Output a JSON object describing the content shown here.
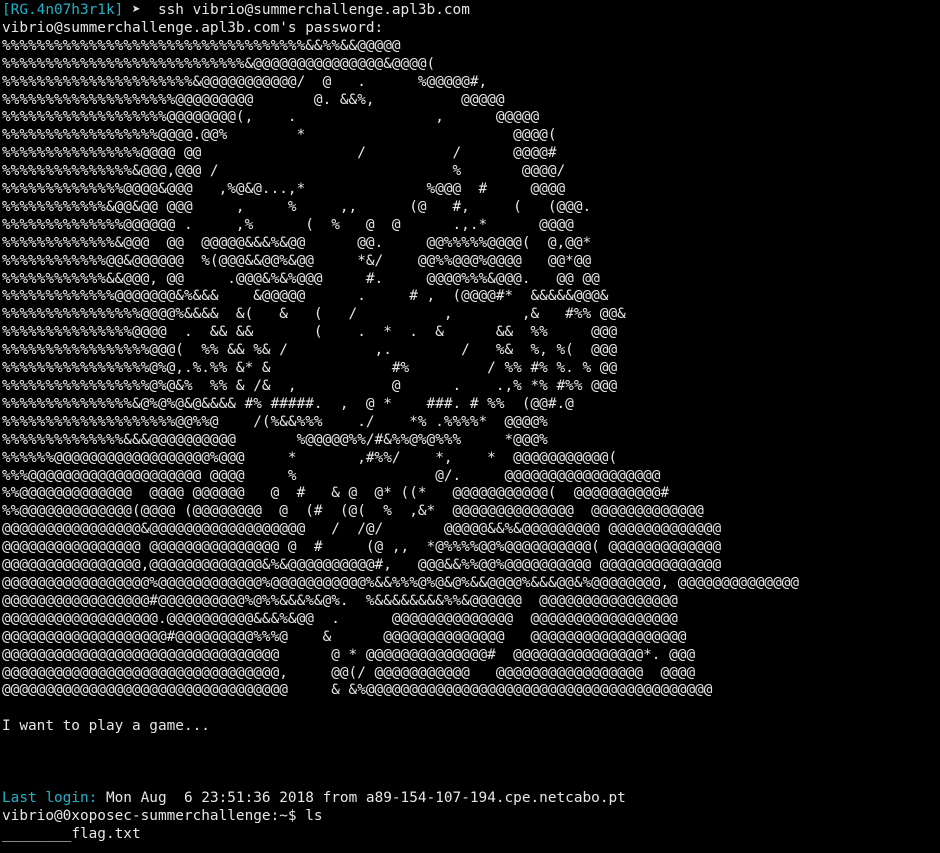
{
  "colors": {
    "background": "#000000",
    "foreground": "#e6e6e6",
    "accent_cyan": "#20b2c6"
  },
  "terminal": {
    "local_prompt": {
      "host_tag": "[RG.4n07h3r1k]",
      "arrow": "➤",
      "command": "ssh vibrio@summerchallenge.apl3b.com"
    },
    "password_prompt": "vibrio@summerchallenge.apl3b.com's password:",
    "ascii_art": [
      "%%%%%%%%%%%%%%%%%%%%%%%%%%%%%%%%%%%&&%%&&@@@@@",
      "%%%%%%%%%%%%%%%%%%%%%%%%%%%%&@@@@@@@@@@@@@@@&@@@@(",
      "%%%%%%%%%%%%%%%%%%%%%%&@@@@@@@@@@@/  @   .      %@@@@@#,",
      "%%%%%%%%%%%%%%%%%%%%@@@@@@@@@       @. &&%,          @@@@@",
      "%%%%%%%%%%%%%%%%%%%@@@@@@@@(,    .                ,      @@@@@",
      "%%%%%%%%%%%%%%%%%%@@@@.@@%        *                        @@@@(",
      "%%%%%%%%%%%%%%%%@@@@ @@                  /          /      @@@@#",
      "%%%%%%%%%%%%%%%&@@@,@@@ /                           %       @@@@/",
      "%%%%%%%%%%%%%%@@@@&@@@   ,%@&@...,*              %@@@  #     @@@@",
      "%%%%%%%%%%%%&@@&@@ @@@     ,     %     ,,      (@   #,     (   (@@@.",
      "%%%%%%%%%%%%%%@@@@@@ .     ,%      (  %   @  @      .,.*      @@@@",
      "%%%%%%%%%%%%%&@@@  @@  @@@@@&&&%&@@      @@.     @@%%%%%@@@@(  @,@@*",
      "%%%%%%%%%%%%@@&@@@@@@  %(@@@&&@@%&@@     *&/    @@%%@@@%@@@@   @@*@@",
      "%%%%%%%%%%%%&&@@@, @@     .@@@&%&%@@@     #.     @@@@%%%&@@@.   @@ @@",
      "%%%%%%%%%%%%%@@@@@@@&%&&&    &@@@@@      .     # ,  (@@@@#*  &&&&&@@@&",
      "%%%%%%%%%%%%%%%%@@@@%&&&&  &(   &   (   /          ,        ,&   #%% @@&",
      "%%%%%%%%%%%%%%%@@@@  .  && &&       (    .  *  .  &      &&  %%     @@@",
      "%%%%%%%%%%%%%%%%%@@@(  %% && %& /          ,.        /   %&  %, %(  @@@",
      "%%%%%%%%%%%%%%%%%@%@,.%.%% &* &              #%         / %% #% %. % @@",
      "%%%%%%%%%%%%%%%%%@%@&%  %% & /&  ,           @      .    .,% *% #%% @@@",
      "%%%%%%%%%%%%%%%&@%@%@&@&&&& #% #####.  ,  @ *    ###. # %%  (@@#.@",
      "%%%%%%%%%%%%%%%%%%%%@@%%@    /(%&&%%%    ./    *% .%%%%*  @@@@%",
      "%%%%%%%%%%%%%%&&&@@@@@@@@@@       %@@@@@%%/#&%%@%@%%%     *@@@%",
      "%%%%%%@@@@@@@@@@@@@@@@@@%@@@     *       ,#%%/    *,    *  @@@@@@@@@@@(",
      "%%%@@@@@@@@@@@@@@@@@@@@ @@@@     %                @/.     @@@@@@@@@@@@@@@@@@",
      "%%@@@@@@@@@@@@@  @@@@ @@@@@@   @  #   & @  @* ((*   @@@@@@@@@@@(  @@@@@@@@@@#",
      "%%@@@@@@@@@@@@@(@@@@ (@@@@@@@@  @  (#  (@(  %  ,&*  @@@@@@@@@@@@@@  @@@@@@@@@@@@@",
      "@@@@@@@@@@@@@@@@&@@@@@@@@@@@@@@@@@@   /  /@/       @@@@@&&%&@@@@@@@@@ @@@@@@@@@@@@@",
      "@@@@@@@@@@@@@@@@ @@@@@@@@@@@@@@@ @  #     (@ ,,  *@%%%%@@%@@@@@@@@@@( @@@@@@@@@@@@@",
      "@@@@@@@@@@@@@@@@,@@@@@@@@@@@@@&%&@@@@@@@@@@#,   @@@&&%%@@%@@@@@@@@@@ @@@@@@@@@@@@@@",
      "@@@@@@@@@@@@@@@@@%@@@@@@@@@@@@%@@@@@@@@@@@%&&%%%@%@&@%&&@@@@%&&&@@&%@@@@@@@@, @@@@@@@@@@@@@@",
      "@@@@@@@@@@@@@@@@@#@@@@@@@@@@%@%%&&&%&@%.  %&&&&&&&&%%&@@@@@@  @@@@@@@@@@@@@@@@",
      "@@@@@@@@@@@@@@@@@@.@@@@@@@@@@&&&%&@@  .      @@@@@@@@@@@@@@  @@@@@@@@@@@@@@@@@",
      "@@@@@@@@@@@@@@@@@@@#@@@@@@@@@%%%@    &      @@@@@@@@@@@@@@   @@@@@@@@@@@@@@@@@@",
      "@@@@@@@@@@@@@@@@@@@@@@@@@@@@@@@@      @ * @@@@@@@@@@@@@@#  @@@@@@@@@@@@@@@*. @@@",
      "@@@@@@@@@@@@@@@@@@@@@@@@@@@@@@@@,     @@(/ @@@@@@@@@@@   @@@@@@@@@@@@@@@@@  @@@@",
      "@@@@@@@@@@@@@@@@@@@@@@@@@@@@@@@@@     & &%@@@@@@@@@@@@@@@@@@@@@@@@@@@@@@@@@@@@@@@@"
    ],
    "banner": "I want to play a game...",
    "last_login": {
      "label": "Last login:",
      "value": "Mon Aug  6 23:51:36 2018 from a89-154-107-194.cpe.netcabo.pt"
    },
    "remote_prompt": {
      "user_host": "vibrio@0xoposec-summerchallenge:~$",
      "command": "ls"
    },
    "ls_output": {
      "prefix": "________",
      "file": "flag.txt"
    }
  }
}
